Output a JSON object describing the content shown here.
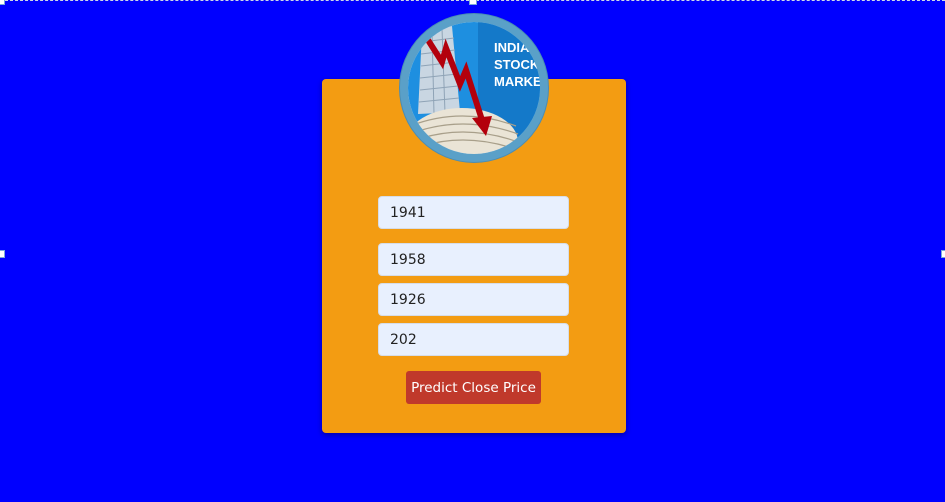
{
  "logo": {
    "text_lines": [
      "INDIA",
      "STOCK",
      "MARKET"
    ],
    "icon": "stock-market-logo-icon"
  },
  "form": {
    "fields": [
      {
        "value": "1941"
      },
      {
        "value": "1958"
      },
      {
        "value": "1926"
      },
      {
        "value": "202"
      }
    ],
    "submit_label": "Predict Close Price"
  },
  "colors": {
    "background": "#0000ff",
    "card": "#f39c12",
    "button": "#c0392b",
    "input_bg": "#e8f0fe"
  }
}
